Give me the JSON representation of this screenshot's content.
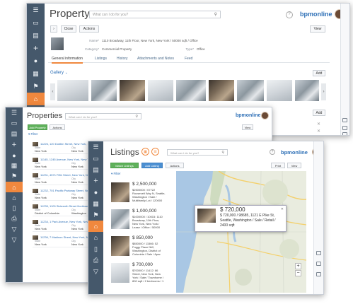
{
  "window1": {
    "title": "Property",
    "search_placeholder": "What can I do for you?",
    "brand": "bpmonline",
    "close_label": "Close",
    "actions_label": "Actions",
    "view_label": "View",
    "fields": {
      "name_label": "Name*",
      "name_value": "1110 Broadway, 11th Floor, New York, New York / 50000 sqft / Office",
      "category_label": "Category*",
      "category_value": "Commercial Property",
      "type_label": "Type*",
      "type_value": "Office"
    },
    "tabs": [
      "General information",
      "Listings",
      "History",
      "Attachments and Notes",
      "Feed"
    ],
    "gallery_label": "Gallery",
    "add_label": "Add"
  },
  "window2": {
    "title": "Properties",
    "search_placeholder": "What can I do for you?",
    "brand": "bpmonline",
    "add_property_label": "Add Property",
    "actions_label": "Actions",
    "view_label": "View",
    "filter_label": "Filter",
    "rows": [
      {
        "title": "11226, 120 Dobbin Street, New York, New York / 50000 sqft / Industrial",
        "state_label": "State",
        "state": "New York",
        "city_label": "City",
        "city": "New York"
      },
      {
        "title": "11145, 1245 Avenue, New York, New York / 50000 sqft / Office",
        "state_label": "State",
        "state": "New York",
        "city_label": "City",
        "city": "New York"
      },
      {
        "title": "11231, 4571 Fifth Street, New York, New York",
        "state_label": "State",
        "state": "New York",
        "city_label": "City",
        "city": "New York"
      },
      {
        "title": "11232, 701 Pacific Parkway Street, New York, New York",
        "state_label": "State",
        "state": "New York",
        "city_label": "City",
        "city": "New York"
      },
      {
        "title": "11235, 1100 Sixteenth Street Northwest, Washington",
        "state_label": "State",
        "state": "District of Columbia",
        "city_label": "City",
        "city": "Washington"
      },
      {
        "title": "11234, 1 Park Avenue, New York, New York",
        "state_label": "State",
        "state": "New York",
        "city_label": "City",
        "city": "New York"
      },
      {
        "title": "11236, 7 Madison Street, New York, New York",
        "state_label": "State",
        "state": "New York",
        "city_label": "City",
        "city": "New York"
      }
    ]
  },
  "window3": {
    "title": "Listings",
    "search_placeholder": "What can I do for you?",
    "brand": "bpmonline",
    "match_listings_label": "Match Listings",
    "add_listing_label": "Add Listing",
    "actions_label": "Actions",
    "print_label": "Print",
    "view_label": "View",
    "filter_label": "Filter",
    "listings": [
      {
        "price": "$ 2,500,000",
        "line1": "$2500000 / 07722",
        "line2": "Roosevelt Way N, Seattle,",
        "line3": "Washington / Sale /",
        "line4": "Multifamily Lot / 120000"
      },
      {
        "price": "$ 1,000,000",
        "line1": "$1000000 / 10015: 1110",
        "line2": "Broadway, 11th Floor,",
        "line3": "New York, New York /",
        "line4": "Lease / Office / 50000"
      },
      {
        "price": "$ 850,000",
        "line1": "$850000 / 11566: 52",
        "line2": "Foggy Place NW,",
        "line3": "Washington, District of",
        "line4": "Columbia / Sale / Apar"
      },
      {
        "price": "$ 700,000",
        "line1": "$700000 / 11412: 86",
        "line2": "Street, New York, New",
        "line3": "York / Sale / Townhome /",
        "line4": "800 sqft / 2 bedrooms / 1"
      }
    ],
    "popup": {
      "price": "$ 720,000",
      "line1": "$ 720,000 / 98685, 1121 E Pike St,",
      "line2": "Seattle, Washington / Sale / Retail /",
      "line3": "2400 sqft"
    }
  },
  "colors": {
    "sidebar": "#45586b",
    "accent": "#f0883e",
    "brand": "#2d6fb6",
    "green_button": "#5fb15b",
    "blue_button": "#4b8fd2"
  }
}
